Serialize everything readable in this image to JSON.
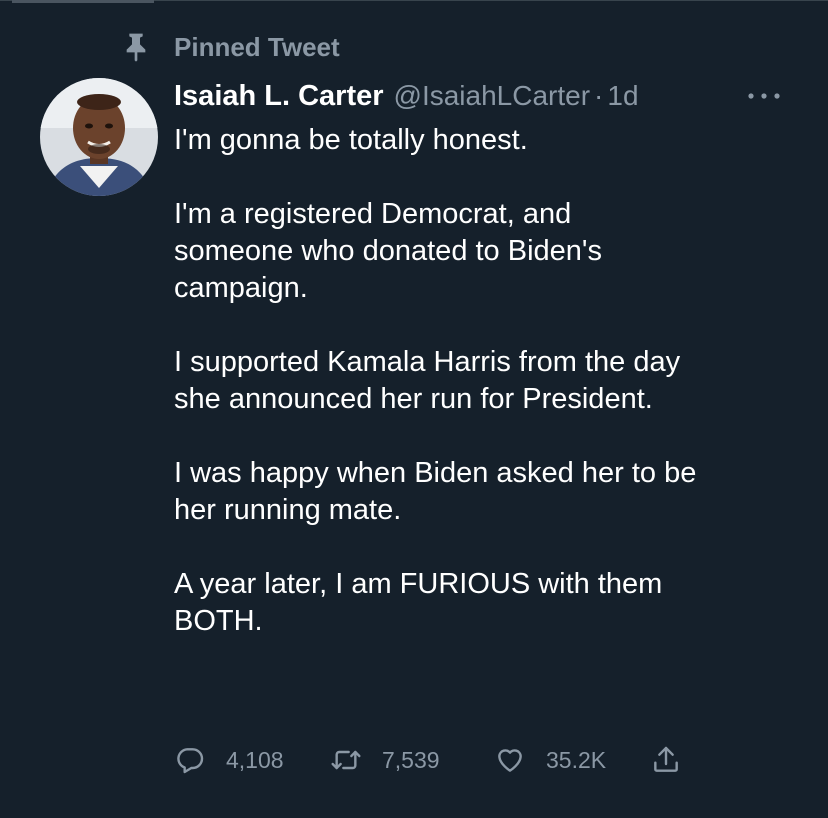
{
  "pinned": {
    "label": "Pinned Tweet",
    "icon": "pin-icon"
  },
  "tweet": {
    "author_name": "Isaiah L. Carter",
    "author_handle": "@IsaiahLCarter",
    "separator": "·",
    "timestamp": "1d",
    "more_icon": "more-horizontal-icon",
    "paragraphs": [
      "I'm gonna be totally honest.",
      "I'm a registered Democrat, and\nsomeone who donated to Biden's\ncampaign.",
      "I supported Kamala Harris from the day\nshe announced her run for President.",
      "I was happy when Biden asked her to be\nher running mate.",
      "A year later, I am FURIOUS with them\nBOTH."
    ]
  },
  "actions": {
    "reply": {
      "icon": "reply-icon",
      "count": "4,108"
    },
    "retweet": {
      "icon": "retweet-icon",
      "count": "7,539"
    },
    "like": {
      "icon": "heart-icon",
      "count": "35.2K"
    },
    "share": {
      "icon": "share-icon"
    }
  },
  "colors": {
    "background": "#15202b",
    "text_primary": "#ffffff",
    "text_secondary": "#8b98a5",
    "divider": "#38444d"
  }
}
